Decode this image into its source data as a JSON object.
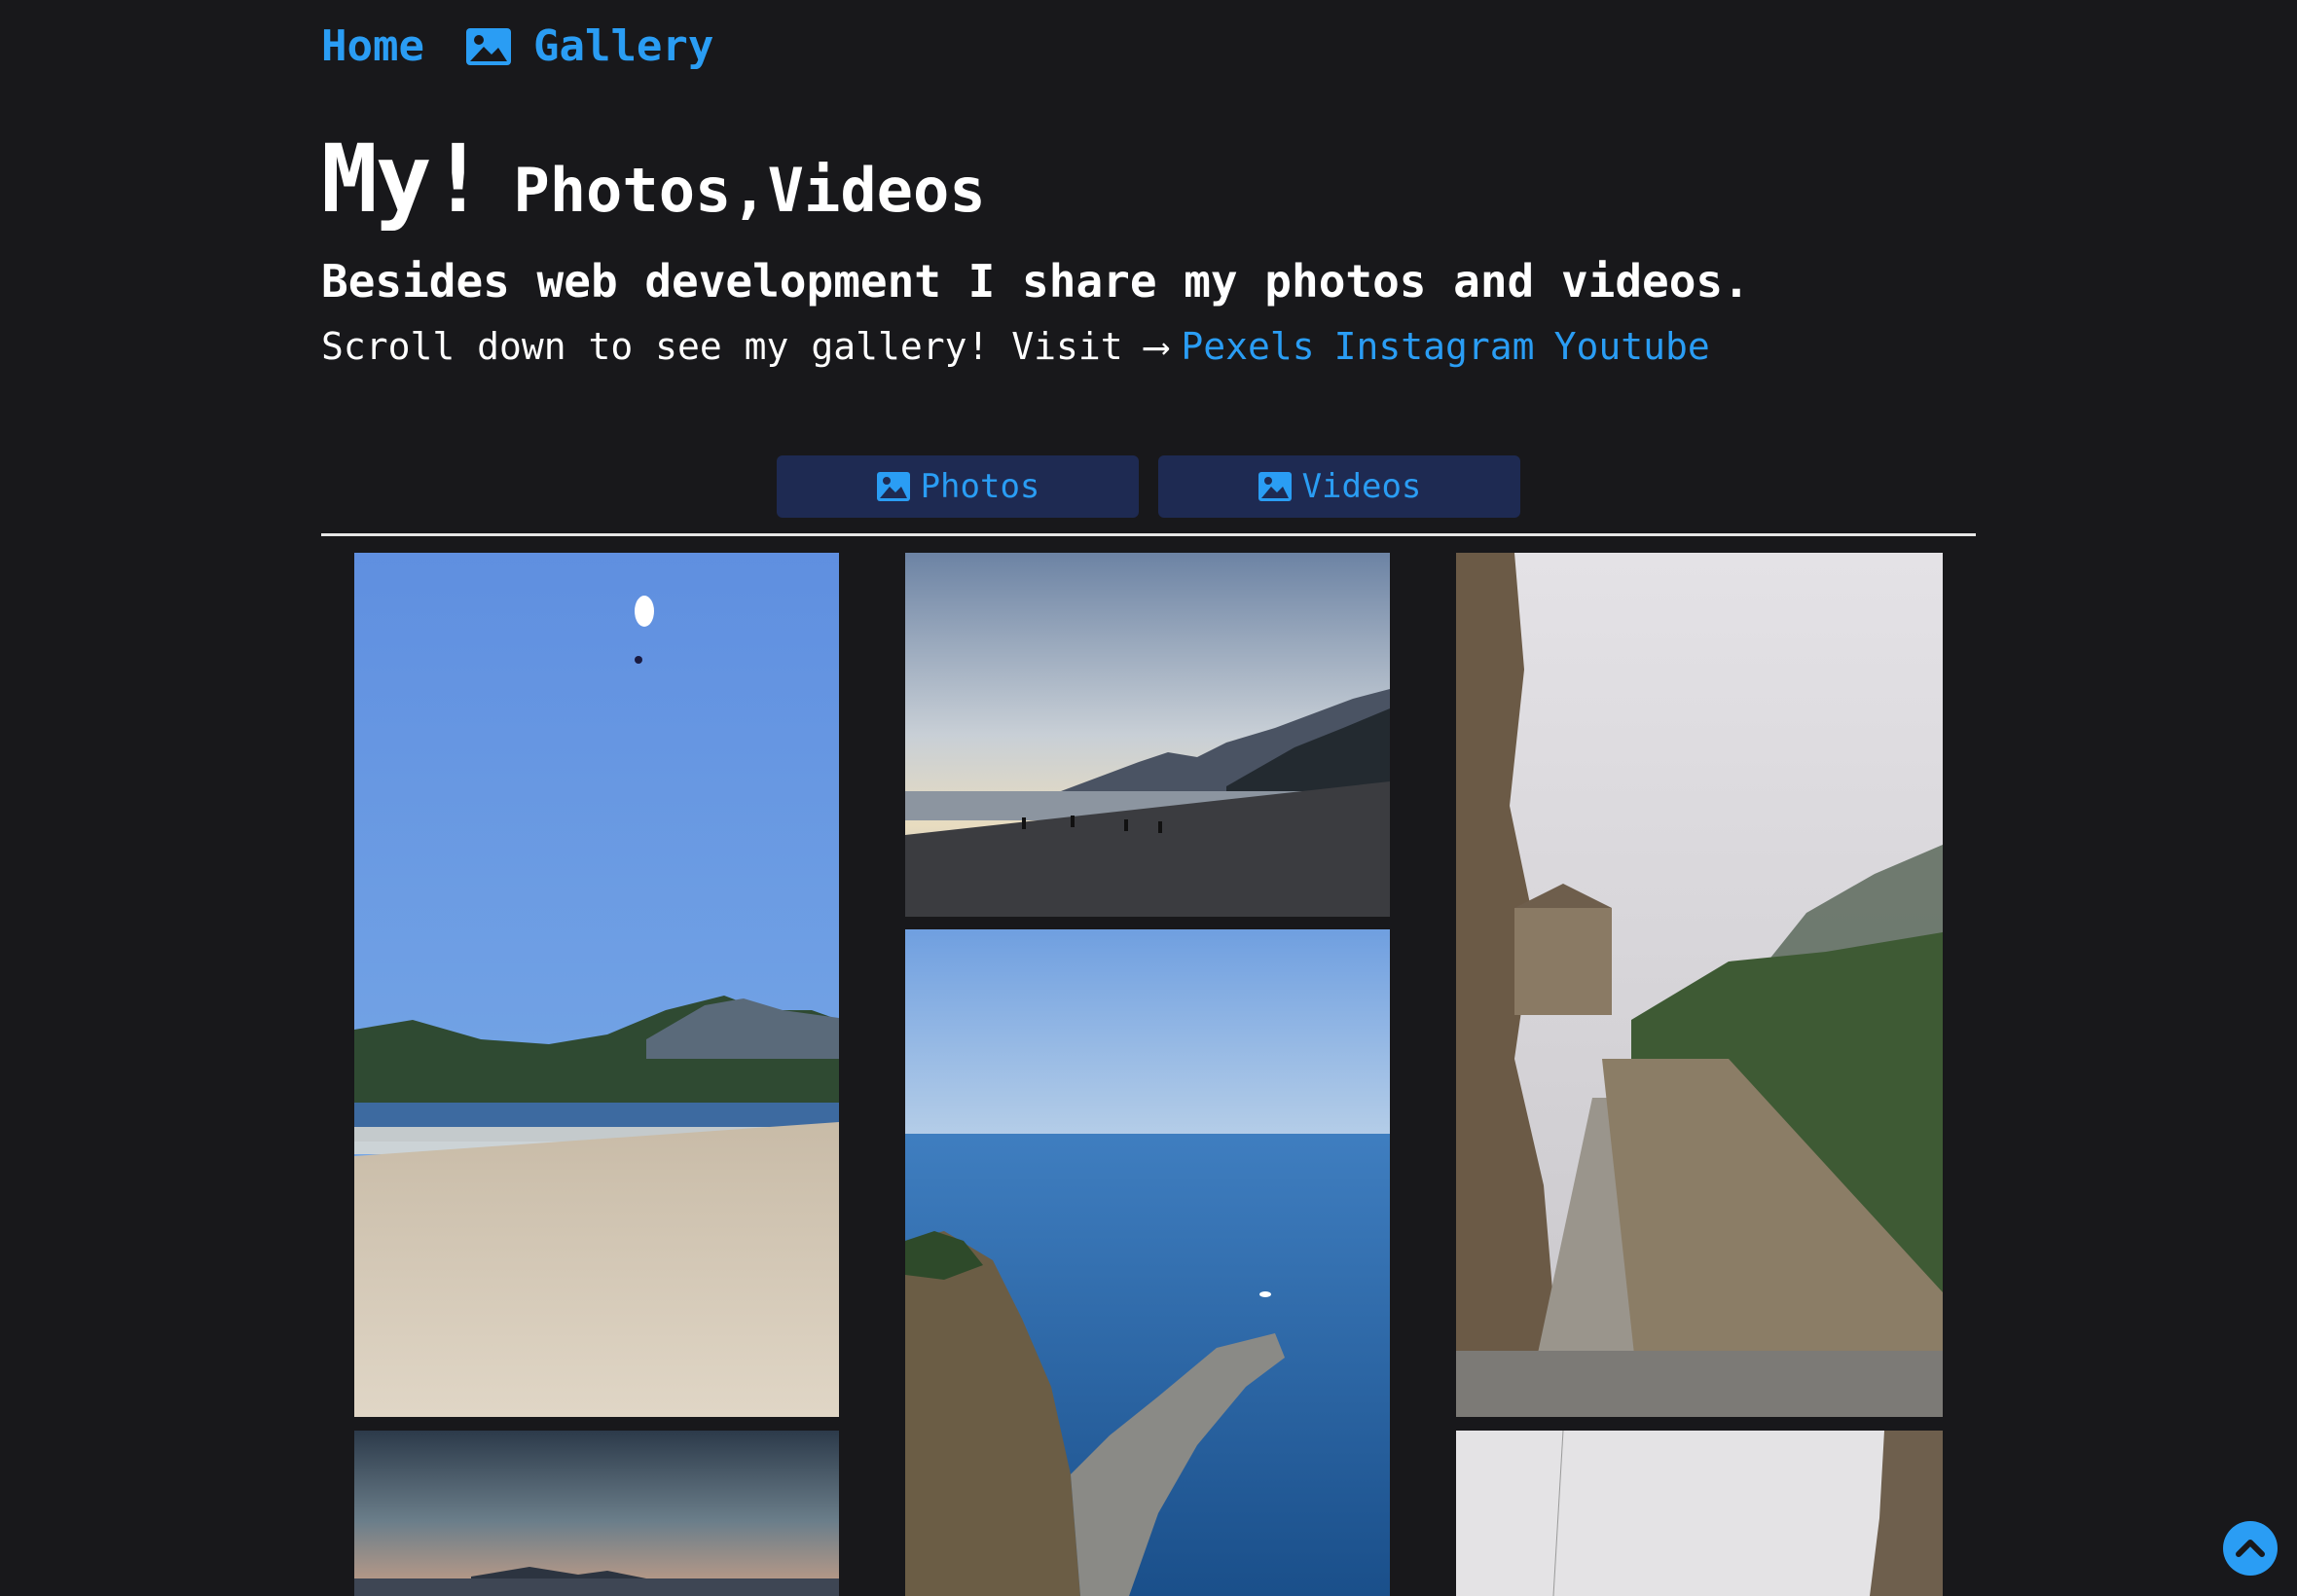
{
  "nav": {
    "home": "Home",
    "gallery": "Gallery"
  },
  "hero": {
    "title_big": "My!",
    "title_small": "Photos,Videos",
    "subtitle": "Besides web development I share my photos and videos.",
    "line_text": "Scroll down to see my gallery! Visit ⟶",
    "links": [
      "Pexels",
      "Instagram",
      "Youtube"
    ]
  },
  "tabs": [
    {
      "label": "Photos",
      "icon": "image-icon"
    },
    {
      "label": "Videos",
      "icon": "image-icon"
    }
  ],
  "photos": [
    "beach-paraglider",
    "coast-sunset",
    "mountain-stairs",
    "ocean-cliff",
    "dusk-sea",
    "foggy-cliff"
  ],
  "colors": {
    "background": "#18181b",
    "accent": "#2a9df4",
    "tab_background": "#1e2a52"
  },
  "scroll_top_icon": "chevron-up-icon"
}
